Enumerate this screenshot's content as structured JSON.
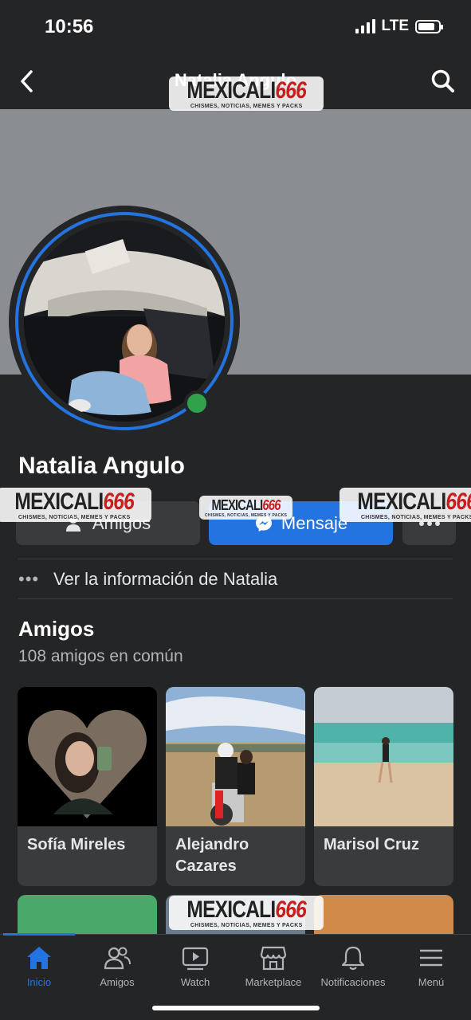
{
  "status_bar": {
    "time": "10:56",
    "network": "LTE",
    "battery_level": 0.85
  },
  "nav": {
    "title": "Natalia Angulo"
  },
  "profile": {
    "name": "Natalia Angulo",
    "online": true,
    "buttons": {
      "friends": "Amigos",
      "message": "Mensaje"
    },
    "info_link": "Ver la información de Natalia"
  },
  "friends_section": {
    "title": "Amigos",
    "subtitle": "108 amigos en común",
    "cards": [
      {
        "name": "Sofía Mireles"
      },
      {
        "name": "Alejandro Cazares"
      },
      {
        "name": "Marisol Cruz"
      }
    ]
  },
  "tab_bar": {
    "tabs": [
      {
        "label": "Inicio",
        "icon": "home-icon",
        "active": true
      },
      {
        "label": "Amigos",
        "icon": "friends-icon",
        "active": false
      },
      {
        "label": "Watch",
        "icon": "watch-icon",
        "active": false
      },
      {
        "label": "Marketplace",
        "icon": "marketplace-icon",
        "active": false
      },
      {
        "label": "Notificaciones",
        "icon": "bell-icon",
        "active": false
      },
      {
        "label": "Menú",
        "icon": "menu-icon",
        "active": false
      }
    ]
  },
  "watermark": {
    "brand_a": "MEXICALI",
    "brand_b": "666",
    "tagline": "CHISMES, NOTICIAS, MEMES Y PACKS"
  },
  "colors": {
    "accent": "#2374e1",
    "online": "#31a24c",
    "background": "#242526",
    "card": "#3a3b3c"
  }
}
